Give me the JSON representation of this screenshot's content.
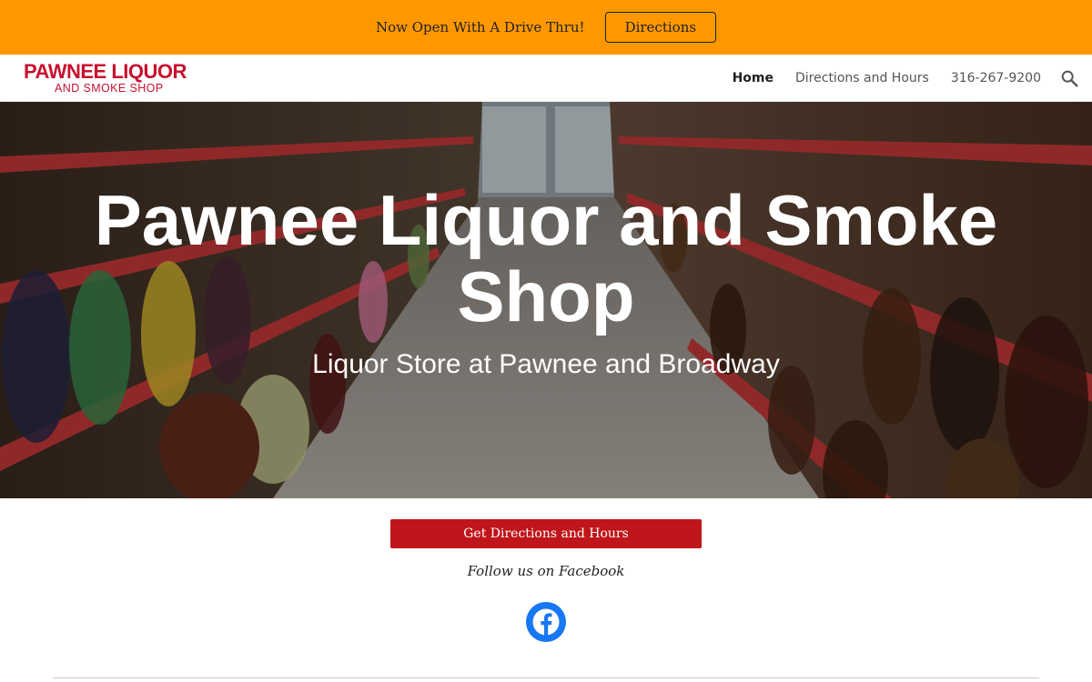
{
  "announcement": {
    "text": "Now Open With A Drive Thru!",
    "button_label": "Directions"
  },
  "header": {
    "logo": {
      "line1": "PAWNEE LIQUOR",
      "line2": "AND SMOKE SHOP"
    },
    "nav": [
      {
        "label": "Home",
        "active": true
      },
      {
        "label": "Directions and Hours",
        "active": false
      },
      {
        "label": "316-267-9200",
        "active": false
      }
    ],
    "search_icon": "search-icon"
  },
  "hero": {
    "title": "Pawnee Liquor and Smoke Shop",
    "subtitle": "Liquor Store at Pawnee and Broadway"
  },
  "main": {
    "cta_label": "Get Directions and Hours",
    "follow_text": "Follow us on Facebook",
    "social_icon": "facebook-icon"
  },
  "colors": {
    "announcement_bg": "#ff9800",
    "brand_red": "#c8102e",
    "cta_bg": "#c0151a",
    "facebook_blue": "#1877f2"
  }
}
